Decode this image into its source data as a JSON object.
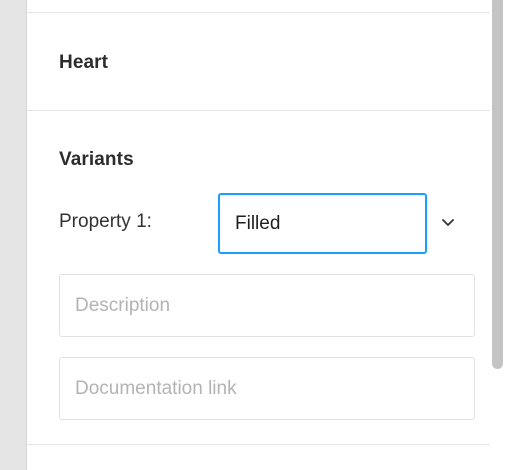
{
  "panel": {
    "component_name": "Heart",
    "variants_title": "Variants",
    "property_label": "Property 1:",
    "property_value": "Filled",
    "description_placeholder": "Description",
    "documentation_placeholder": "Documentation link"
  },
  "colors": {
    "accent": "#18a0fb",
    "panel_bg": "#ffffff",
    "canvas_bg": "#e5e5e5",
    "border": "#e1e1e1"
  },
  "icons": {
    "dropdown": "chevron-down-icon"
  }
}
